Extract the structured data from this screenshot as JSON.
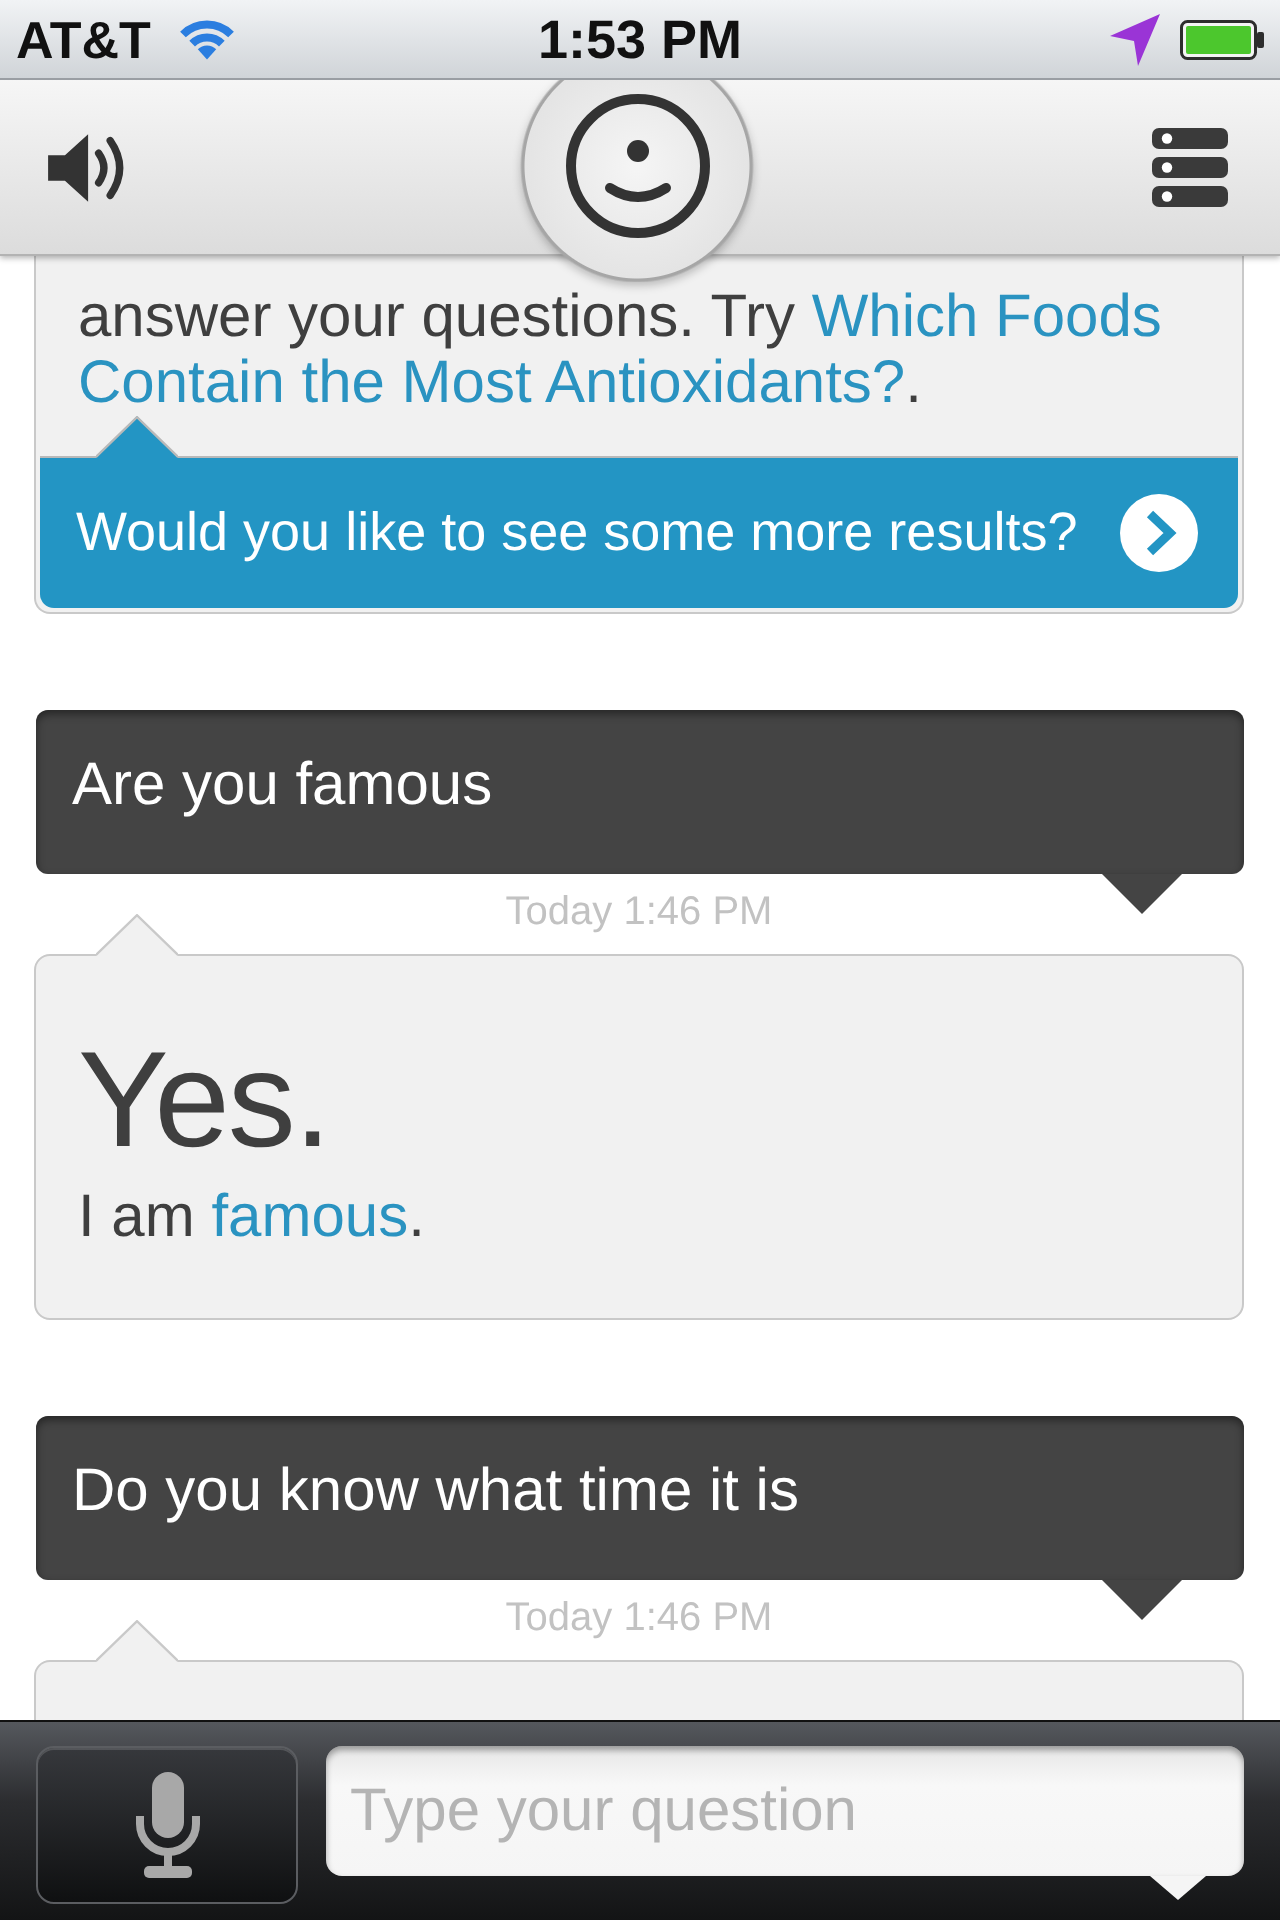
{
  "status_bar": {
    "carrier": "AT&T",
    "time": "1:53 PM"
  },
  "messages": [
    {
      "kind": "answer",
      "paragraph": [
        {
          "kind": "text",
          "text": "answer your questions. Try "
        },
        {
          "kind": "link",
          "parts": [
            "Which Foods",
            "Contain the Most Antioxidants?"
          ]
        },
        {
          "kind": "text",
          "text": "."
        }
      ],
      "more_results": "Would you like to see some more results?"
    },
    {
      "kind": "question",
      "text": "Are you famous",
      "time": "Today 1:46 PM"
    },
    {
      "kind": "answer",
      "headline": "Yes.",
      "paragraph": [
        {
          "kind": "text",
          "text": "I am "
        },
        {
          "kind": "link",
          "parts": [
            "famous"
          ]
        },
        {
          "kind": "text",
          "text": "."
        }
      ]
    },
    {
      "kind": "question",
      "text": "Do you know what time it is",
      "time": "Today 1:46 PM"
    },
    {
      "kind": "answer"
    }
  ],
  "input": {
    "placeholder": "Type your question"
  }
}
